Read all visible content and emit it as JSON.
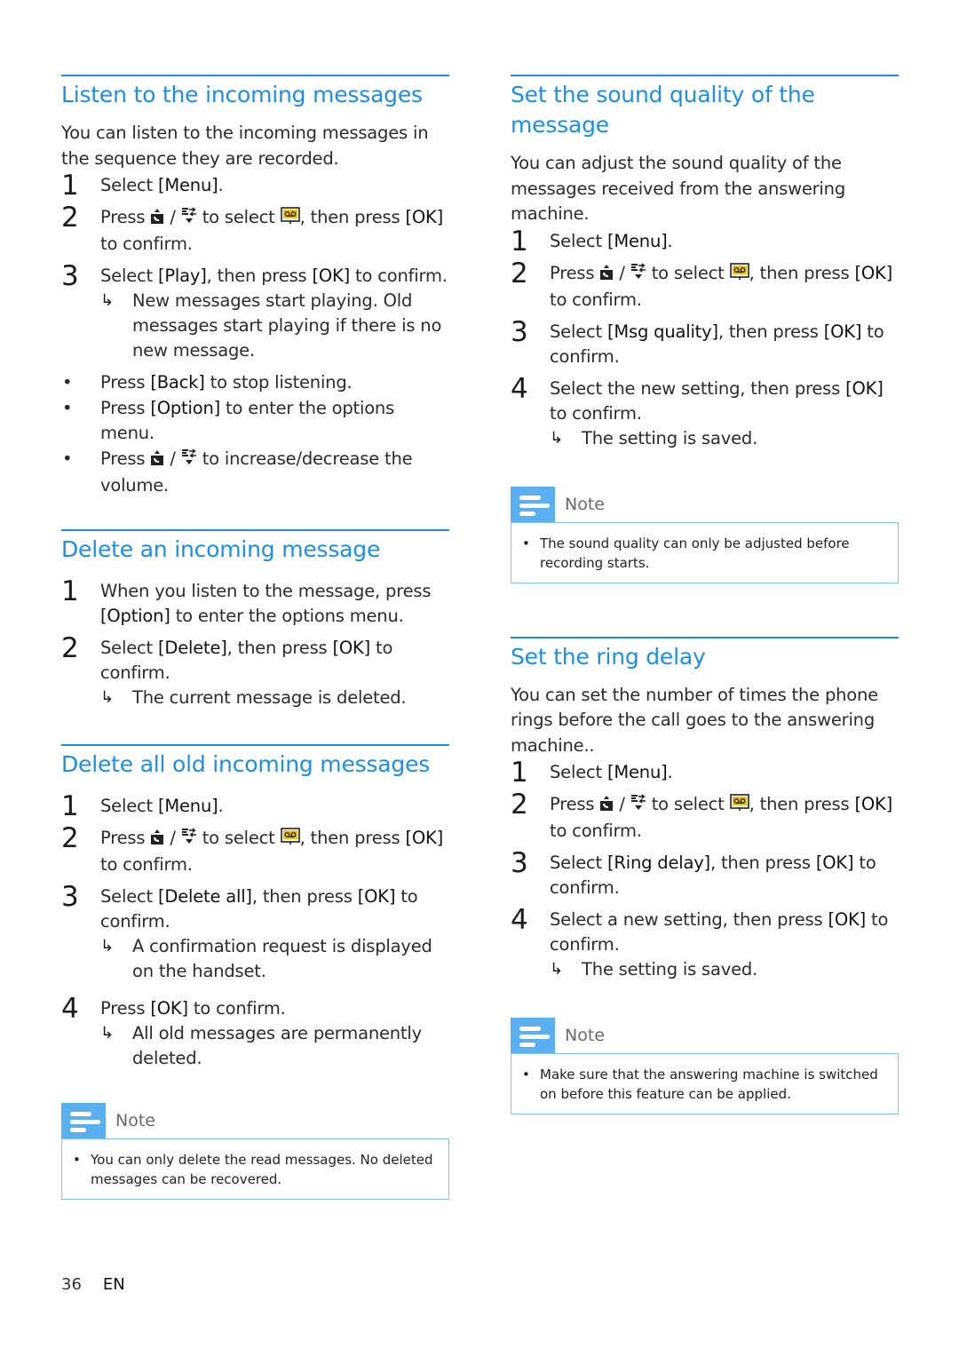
{
  "page": {
    "number": "36",
    "language": "EN"
  },
  "icons": {
    "up": "handset-up-icon",
    "down": "handset-down-icon",
    "menu_target": "answering-machine-icon",
    "result": "result-arrow",
    "result_glyph": "↳",
    "bullet_glyph": "•"
  },
  "left_column": {
    "listen": {
      "title": "Listen to the incoming messages",
      "intro": "You can listen to the incoming messages in the sequence they are recorded.",
      "steps": [
        {
          "num": "1",
          "pre": "Select ",
          "kw": "[Menu]",
          "post": "."
        },
        {
          "num": "2",
          "pre": "Press ",
          "mid": " / ",
          "sel": " to select ",
          "post_icon": ", then press ",
          "kw": "[OK]",
          "post": " to confirm."
        },
        {
          "num": "3",
          "pre": "Select ",
          "kw": "[Play]",
          "mid": ", then press ",
          "kw2": "[OK]",
          "post": " to confirm.",
          "result": "New messages start playing. Old messages start playing if there is no new message."
        }
      ],
      "bullets": [
        {
          "pre": "Press ",
          "kw": "[Back]",
          "post": " to stop listening."
        },
        {
          "pre": "Press ",
          "kw": "[Option]",
          "post": " to enter the options menu."
        },
        {
          "pre": "Press ",
          "mid": " / ",
          "post": " to increase/decrease the volume."
        }
      ]
    },
    "delete_one": {
      "title": "Delete an incoming message",
      "steps": [
        {
          "num": "1",
          "pre": "When you listen to the message, press ",
          "kw": "[Option]",
          "post": " to enter the options menu."
        },
        {
          "num": "2",
          "pre": "Select ",
          "kw": "[Delete]",
          "mid": ", then press ",
          "kw2": "[OK]",
          "post": " to confirm.",
          "result": "The current message is deleted."
        }
      ]
    },
    "delete_all": {
      "title": "Delete all old incoming messages",
      "steps": [
        {
          "num": "1",
          "pre": "Select ",
          "kw": "[Menu]",
          "post": "."
        },
        {
          "num": "2",
          "pre": "Press ",
          "mid": " / ",
          "sel": " to select ",
          "post_icon": ", then press ",
          "kw": "[OK]",
          "post": " to confirm."
        },
        {
          "num": "3",
          "pre": "Select ",
          "kw": "[Delete all]",
          "mid": ", then press ",
          "kw2": "[OK]",
          "post": " to confirm.",
          "result": "A confirmation request is displayed on the handset."
        },
        {
          "num": "4",
          "pre": "Press ",
          "kw": "[OK]",
          "post": " to confirm.",
          "result": "All old messages are permanently deleted."
        }
      ],
      "note": {
        "label": "Note",
        "text": "You can only delete the read messages. No deleted messages can be recovered."
      }
    }
  },
  "right_column": {
    "sound_quality": {
      "title": "Set the sound quality of the message",
      "intro": "You can adjust the sound quality of the messages received from the answering machine.",
      "steps": [
        {
          "num": "1",
          "pre": "Select ",
          "kw": "[Menu]",
          "post": "."
        },
        {
          "num": "2",
          "pre": "Press ",
          "mid": " / ",
          "sel": " to select ",
          "post_icon": ", then press ",
          "kw": "[OK]",
          "post": " to confirm."
        },
        {
          "num": "3",
          "pre": "Select ",
          "kw": "[Msg quality]",
          "mid": ", then press ",
          "kw2": "[OK]",
          "post": " to confirm."
        },
        {
          "num": "4",
          "pre": "Select the new setting, then press ",
          "kw": "[OK]",
          "post": " to confirm.",
          "result": "The setting is saved."
        }
      ],
      "note": {
        "label": "Note",
        "text": "The sound quality can only be adjusted before recording starts."
      }
    },
    "ring_delay": {
      "title": "Set the ring delay",
      "intro": "You can set the number of times the phone rings before the call goes to the answering machine..",
      "steps": [
        {
          "num": "1",
          "pre": "Select ",
          "kw": "[Menu]",
          "post": "."
        },
        {
          "num": "2",
          "pre": "Press ",
          "mid": " / ",
          "sel": " to select ",
          "post_icon": ", then press ",
          "kw": "[OK]",
          "post": " to confirm."
        },
        {
          "num": "3",
          "pre": "Select ",
          "kw": "[Ring delay]",
          "mid": ", then press ",
          "kw2": "[OK]",
          "post": " to confirm."
        },
        {
          "num": "4",
          "pre": "Select a new setting, then press ",
          "kw": "[OK]",
          "post": " to confirm.",
          "result": "The setting is saved."
        }
      ],
      "note": {
        "label": "Note",
        "text": "Make sure that the answering machine is switched on before this feature can be applied."
      }
    }
  },
  "colors": {
    "accent": "#1b8fe8",
    "note_icon": "#5aaff0",
    "note_border": "#7fc6f4",
    "machine_icon": "#f2c200"
  }
}
